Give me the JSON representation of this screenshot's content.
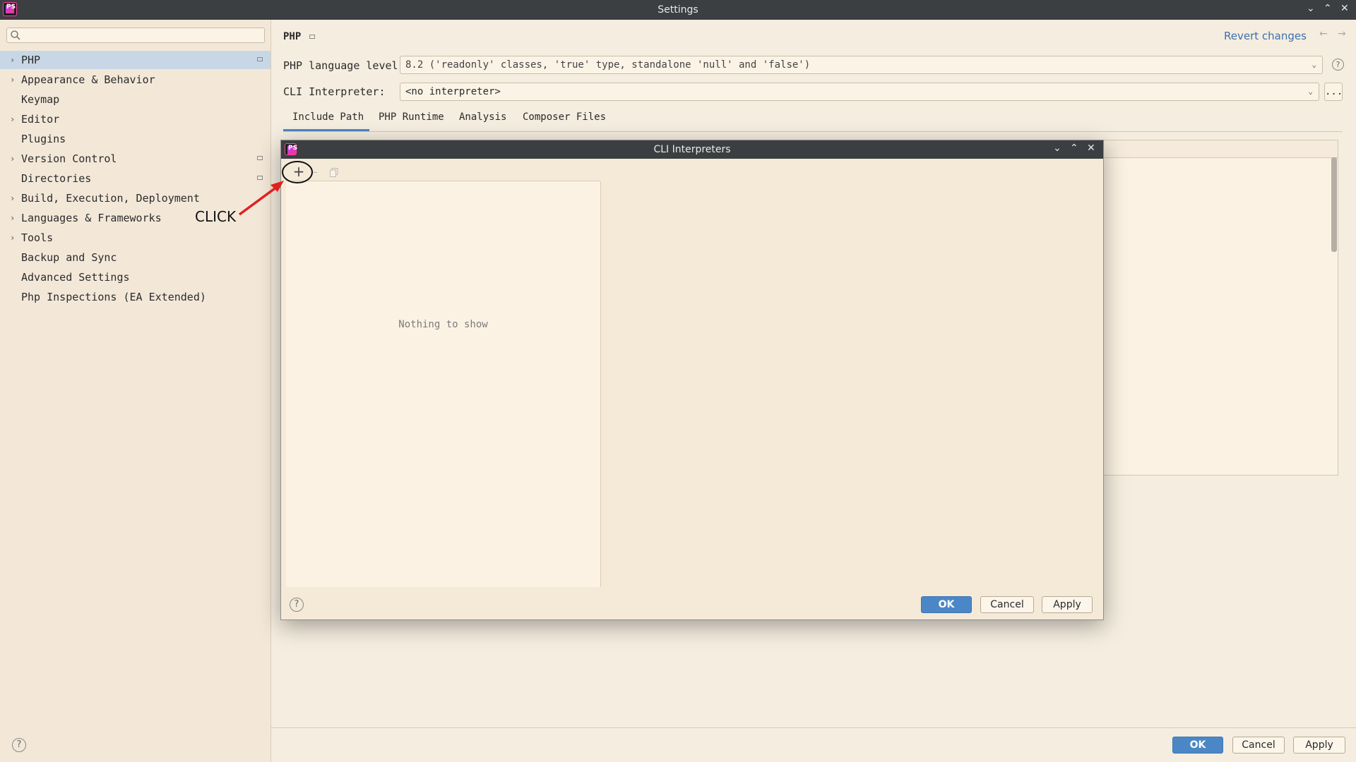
{
  "window": {
    "title": "Settings",
    "app_icon": "PS"
  },
  "search": {
    "placeholder": ""
  },
  "sidebar": {
    "items": [
      {
        "label": "PHP",
        "expandable": true,
        "selected": true,
        "marker": true
      },
      {
        "label": "Appearance & Behavior",
        "expandable": true
      },
      {
        "label": "Keymap",
        "expandable": false
      },
      {
        "label": "Editor",
        "expandable": true
      },
      {
        "label": "Plugins",
        "expandable": false
      },
      {
        "label": "Version Control",
        "expandable": true,
        "marker": true
      },
      {
        "label": "Directories",
        "expandable": false,
        "marker": true
      },
      {
        "label": "Build, Execution, Deployment",
        "expandable": true
      },
      {
        "label": "Languages & Frameworks",
        "expandable": true
      },
      {
        "label": "Tools",
        "expandable": true
      },
      {
        "label": "Backup and Sync",
        "expandable": false
      },
      {
        "label": "Advanced Settings",
        "expandable": false
      },
      {
        "label": "Php Inspections (EA Extended)",
        "expandable": false
      }
    ]
  },
  "header": {
    "title": "PHP",
    "revert": "Revert changes"
  },
  "form": {
    "language_level_label": "PHP language level:",
    "language_level_value": "8.2 ('readonly' classes, 'true' type, standalone 'null' and 'false')",
    "cli_label": "CLI Interpreter:",
    "cli_value": "<no interpreter>",
    "browse_label": "..."
  },
  "tabs": [
    "Include Path",
    "PHP Runtime",
    "Analysis",
    "Composer Files"
  ],
  "dialog": {
    "title": "CLI Interpreters",
    "empty_text": "Nothing to show",
    "ok": "OK",
    "cancel": "Cancel",
    "apply": "Apply",
    "help": "?"
  },
  "footer": {
    "ok": "OK",
    "cancel": "Cancel",
    "apply": "Apply",
    "help": "?"
  },
  "annotation": {
    "text": "CLICK",
    "color": "#e02020"
  },
  "colors": {
    "accent": "#4b87c6",
    "selection": "#c7d7e6",
    "titlebar": "#3c3f41"
  }
}
